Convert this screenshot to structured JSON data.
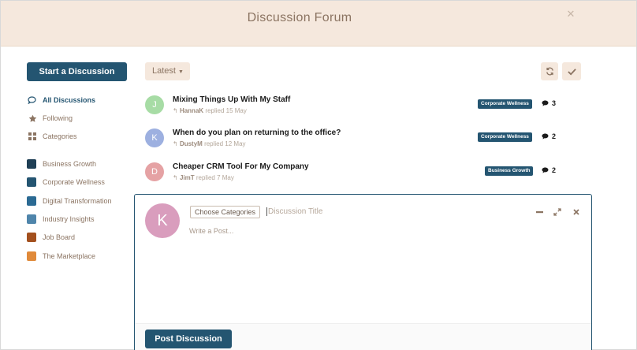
{
  "header": {
    "title": "Discussion Forum"
  },
  "sidebar": {
    "start_label": "Start a Discussion",
    "nav": [
      {
        "label": "All Discussions",
        "icon": "comments-icon",
        "active": true
      },
      {
        "label": "Following",
        "icon": "star-icon",
        "active": false
      },
      {
        "label": "Categories",
        "icon": "grid-icon",
        "active": false
      }
    ],
    "categories": [
      {
        "label": "Business Growth",
        "color": "#1f3f55"
      },
      {
        "label": "Corporate Wellness",
        "color": "#245571"
      },
      {
        "label": "Digital Transformation",
        "color": "#2b6a93"
      },
      {
        "label": "Industry Insights",
        "color": "#4f85ab"
      },
      {
        "label": "Job Board",
        "color": "#a3501e"
      },
      {
        "label": "The Marketplace",
        "color": "#e08a3a"
      }
    ]
  },
  "toolbar": {
    "sort_label": "Latest"
  },
  "discussions": [
    {
      "initial": "J",
      "avatar_color": "#a7dca5",
      "title": "Mixing Things Up With My Staff",
      "user": "HannaK",
      "replied": "replied 15 May",
      "tag": "Corporate Wellness",
      "count": "3"
    },
    {
      "initial": "K",
      "avatar_color": "#9db0e0",
      "title": "When do you plan on returning to the office?",
      "user": "DustyM",
      "replied": "replied 12 May",
      "tag": "Corporate Wellness",
      "count": "2"
    },
    {
      "initial": "D",
      "avatar_color": "#e5a2a4",
      "title": "Cheaper CRM Tool For My Company",
      "user": "JimT",
      "replied": "replied 7 May",
      "tag": "Business Growth",
      "count": "2"
    }
  ],
  "composer": {
    "avatar_initial": "K",
    "choose_label": "Choose Categories",
    "title_placeholder": "Discussion Title",
    "body_placeholder": "Write a Post...",
    "post_label": "Post Discussion"
  }
}
